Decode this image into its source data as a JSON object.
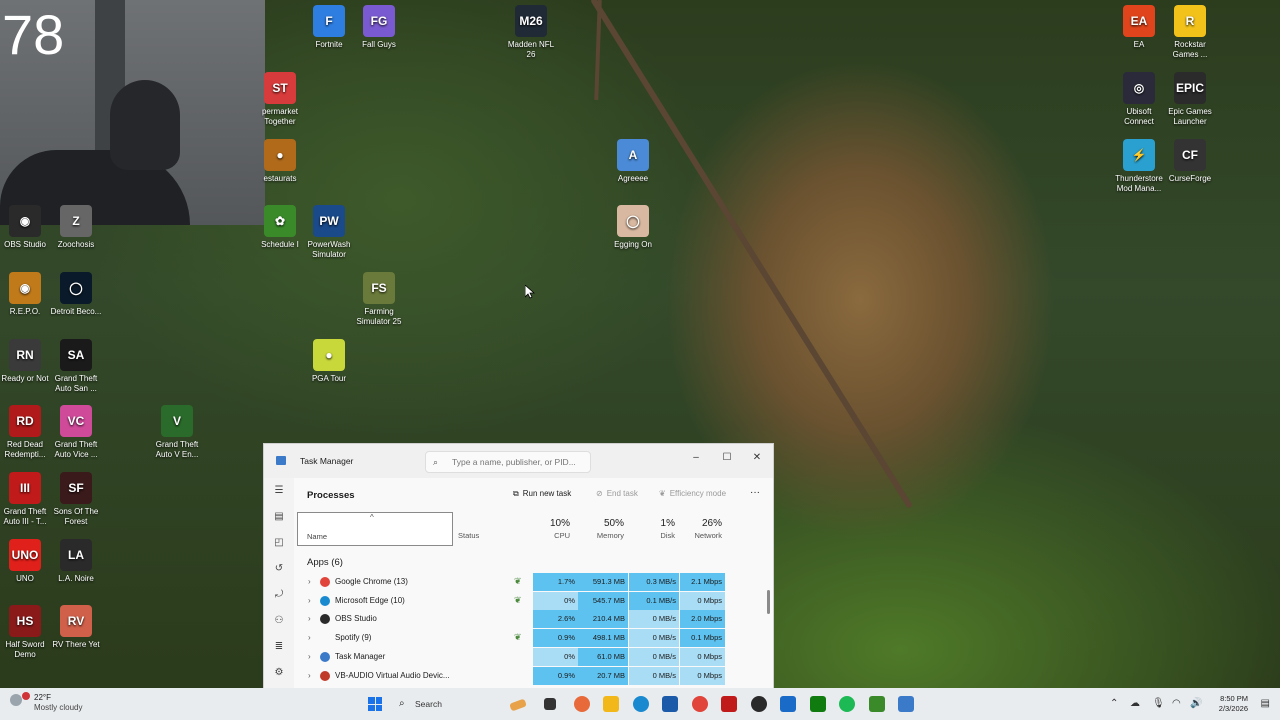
{
  "webcam": {
    "counter": "78"
  },
  "desktop_icons": [
    {
      "label": "Fortnite",
      "color": "#2e7de0",
      "glyph": "F"
    },
    {
      "label": "Fall Guys",
      "color": "#7a5ad0",
      "glyph": "FG"
    },
    {
      "label": "Madden NFL 26",
      "color": "#1f2a36",
      "glyph": "M26"
    },
    {
      "label": "EA",
      "color": "#e0441c",
      "glyph": "EA"
    },
    {
      "label": "Rockstar Games ...",
      "color": "#f2c21b",
      "glyph": "R"
    },
    {
      "label": "permarket Together",
      "color": "#d83b3b",
      "glyph": "ST"
    },
    {
      "label": "Ubisoft Connect",
      "color": "#2a2a3a",
      "glyph": "◎"
    },
    {
      "label": "Epic Games Launcher",
      "color": "#2b2b2b",
      "glyph": "EPIC"
    },
    {
      "label": "estaurats",
      "color": "#b06a1a",
      "glyph": "●"
    },
    {
      "label": "Agreeee",
      "color": "#4a8ad6",
      "glyph": "A"
    },
    {
      "label": "Thunderstore Mod Mana...",
      "color": "#2aa0d0",
      "glyph": "⚡"
    },
    {
      "label": "CurseForge",
      "color": "#333",
      "glyph": "CF"
    },
    {
      "label": "OBS Studio",
      "color": "#2a2a2a",
      "glyph": "◉"
    },
    {
      "label": "Zoochosis",
      "color": "#666",
      "glyph": "Z"
    },
    {
      "label": "Schedule I",
      "color": "#3a8a2a",
      "glyph": "✿"
    },
    {
      "label": "PowerWash Simulator",
      "color": "#1a4a8a",
      "glyph": "PW"
    },
    {
      "label": "Egging On",
      "color": "#d8b8a0",
      "glyph": "◯"
    },
    {
      "label": "R.E.P.O.",
      "color": "#c07a1a",
      "glyph": "◉"
    },
    {
      "label": "Detroit Beco...",
      "color": "#0a1a2a",
      "glyph": "◯"
    },
    {
      "label": "Farming Simulator 25",
      "color": "#6a7a3a",
      "glyph": "FS"
    },
    {
      "label": "Ready or Not",
      "color": "#3a3a3a",
      "glyph": "RN"
    },
    {
      "label": "Grand Theft Auto San ...",
      "color": "#1a1a1a",
      "glyph": "SA"
    },
    {
      "label": "PGA Tour",
      "color": "#c8d83a",
      "glyph": "●"
    },
    {
      "label": "Red Dead Redempti...",
      "color": "#b01a1a",
      "glyph": "RD"
    },
    {
      "label": "Grand Theft Auto Vice ...",
      "color": "#d04a9a",
      "glyph": "VC"
    },
    {
      "label": "Grand Theft Auto V En...",
      "color": "#2a6a2a",
      "glyph": "V"
    },
    {
      "label": "Grand Theft Auto III - T...",
      "color": "#c01a1a",
      "glyph": "III"
    },
    {
      "label": "Sons Of The Forest",
      "color": "#3a1a1a",
      "glyph": "SF"
    },
    {
      "label": "UNO",
      "color": "#e0201a",
      "glyph": "UNO"
    },
    {
      "label": "L.A. Noire",
      "color": "#2a2a2a",
      "glyph": "LA"
    },
    {
      "label": "Half Sword Demo",
      "color": "#8a1a1a",
      "glyph": "HS"
    },
    {
      "label": "RV There Yet",
      "color": "#d0604a",
      "glyph": "RV"
    }
  ],
  "task_manager": {
    "title": "Task Manager",
    "search_placeholder": "Type a name, publisher, or PID...",
    "page_title": "Processes",
    "run_new_task": "Run new task",
    "end_task": "End task",
    "efficiency_mode": "Efficiency mode",
    "more": "···",
    "col_name": "Name",
    "col_status": "Status",
    "cpu_pct": "10%",
    "cpu_label": "CPU",
    "mem_pct": "50%",
    "mem_label": "Memory",
    "disk_pct": "1%",
    "disk_label": "Disk",
    "net_pct": "26%",
    "net_label": "Network",
    "group_label": "Apps (6)",
    "processes": [
      {
        "name": "Google Chrome (13)",
        "icon_color": "#e0443a",
        "eco": true,
        "cpu": "1.7%",
        "mem": "591.3 MB",
        "disk": "0.3 MB/s",
        "net": "2.1 Mbps"
      },
      {
        "name": "Microsoft Edge (10)",
        "icon_color": "#1a8ad0",
        "eco": true,
        "cpu": "0%",
        "mem": "545.7 MB",
        "disk": "0.1 MB/s",
        "net": "0 Mbps"
      },
      {
        "name": "OBS Studio",
        "icon_color": "#2a2a2a",
        "eco": false,
        "cpu": "2.6%",
        "mem": "210.4 MB",
        "disk": "0 MB/s",
        "net": "2.0 Mbps"
      },
      {
        "name": "Spotify (9)",
        "icon_color": "transparent",
        "eco": true,
        "cpu": "0.9%",
        "mem": "498.1 MB",
        "disk": "0 MB/s",
        "net": "0.1 Mbps"
      },
      {
        "name": "Task Manager",
        "icon_color": "#3b79c9",
        "eco": false,
        "cpu": "0%",
        "mem": "61.0 MB",
        "disk": "0 MB/s",
        "net": "0 Mbps"
      },
      {
        "name": "VB-AUDIO Virtual Audio Devic...",
        "icon_color": "#c03a2a",
        "eco": false,
        "cpu": "0.9%",
        "mem": "20.7 MB",
        "disk": "0 MB/s",
        "net": "0 Mbps"
      }
    ]
  },
  "taskbar": {
    "temp": "22°F",
    "condition": "Mostly cloudy",
    "search_label": "Search",
    "time": "8:50 PM",
    "date": "2/3/2026"
  },
  "colors": {
    "cell_strong": "#5ec2f0",
    "cell_light": "#a9dcf5",
    "eco_leaf": "#4b8a3d"
  }
}
